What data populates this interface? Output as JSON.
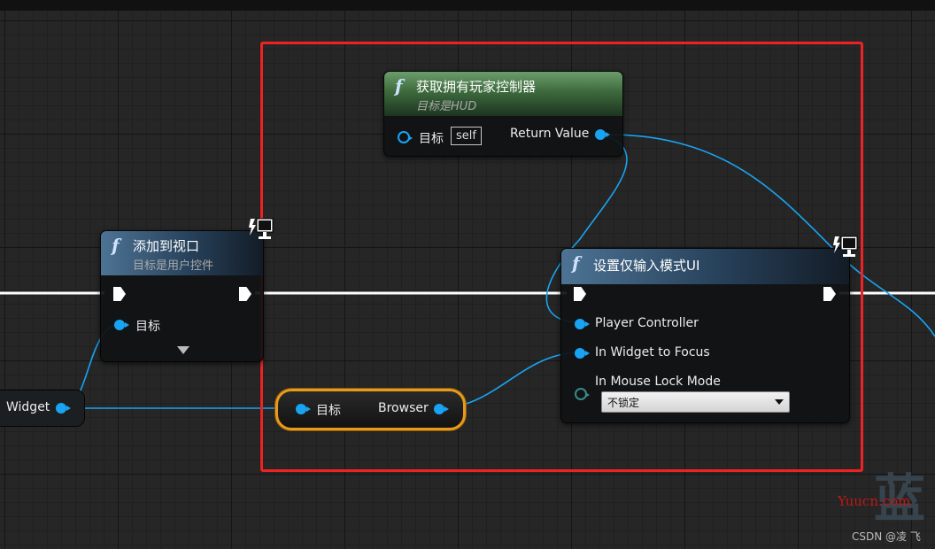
{
  "nodes": {
    "get_controller": {
      "title": "获取拥有玩家控制器",
      "subtitle": "目标是HUD",
      "target_label": "目标",
      "self_value": "self",
      "return_label": "Return Value"
    },
    "add_to_viewport": {
      "title": "添加到视口",
      "subtitle": "目标是用户控件",
      "target_label": "目标"
    },
    "set_input_mode": {
      "title": "设置仅输入模式UI",
      "pins": [
        "Player Controller",
        "In Widget to Focus",
        "In Mouse Lock Mode"
      ],
      "lock_mode_value": "不锁定"
    },
    "browser_getter": {
      "target_label": "目标",
      "output_label": "Browser"
    },
    "widget_node": {
      "label": "Widget"
    }
  },
  "icons": {
    "function": "f",
    "network": "network-monitor-icon"
  },
  "colors": {
    "object_pin": "#19a4f3",
    "exec_wire": "#ffffff",
    "selection": "#ee2222",
    "reroute_border": "#e89a1a",
    "green_header": "#4f844f",
    "blue_header": "#4d7394"
  },
  "watermark": {
    "char": "蓝",
    "site": "Yuucn.com",
    "credit": "CSDN @凌 飞"
  }
}
